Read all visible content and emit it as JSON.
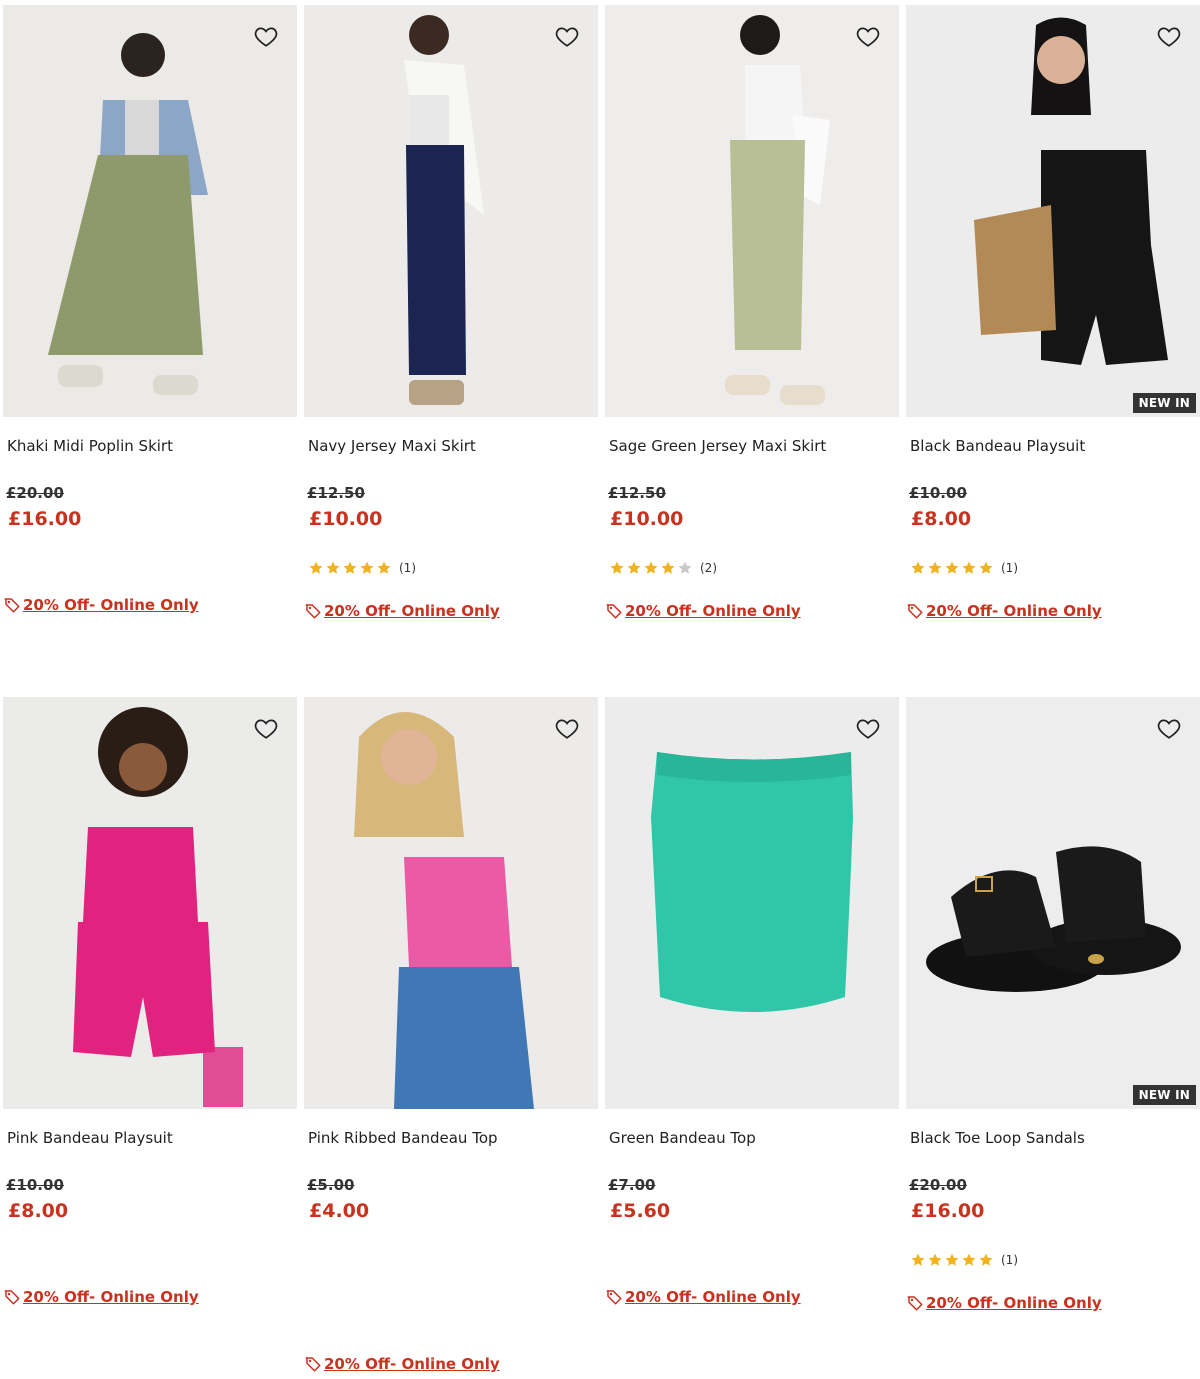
{
  "colors": {
    "accent": "#c8321e",
    "badge_bg": "#333333",
    "star": "#f2b21b",
    "star_empty": "#c9c9c9"
  },
  "icons": {
    "wishlist": "heart-outline-icon",
    "offer": "price-tag-icon",
    "rating": "star-icon"
  },
  "products": [
    {
      "name": "Khaki Midi Poplin Skirt",
      "was": "£20.00",
      "now": "£16.00",
      "rating_stars": null,
      "rating_count": null,
      "offer": "20% Off- Online Only",
      "badge": null
    },
    {
      "name": "Navy Jersey Maxi Skirt",
      "was": "£12.50",
      "now": "£10.00",
      "rating_stars": 5,
      "rating_count": "(1)",
      "offer": "20% Off- Online Only",
      "badge": null
    },
    {
      "name": "Sage Green Jersey Maxi Skirt",
      "was": "£12.50",
      "now": "£10.00",
      "rating_stars": 4,
      "rating_count": "(2)",
      "offer": "20% Off- Online Only",
      "badge": null
    },
    {
      "name": "Black Bandeau Playsuit",
      "was": "£10.00",
      "now": "£8.00",
      "rating_stars": 5,
      "rating_count": "(1)",
      "offer": "20% Off- Online Only",
      "badge": "NEW IN"
    },
    {
      "name": "Pink Bandeau Playsuit",
      "was": "£10.00",
      "now": "£8.00",
      "rating_stars": null,
      "rating_count": null,
      "offer": "20% Off- Online Only",
      "badge": null
    },
    {
      "name": "Pink Ribbed Bandeau Top",
      "was": "£5.00",
      "now": "£4.00",
      "rating_stars": null,
      "rating_count": null,
      "offer": "20% Off- Online Only",
      "badge": null,
      "swatches": [
        "#1b2646",
        "#e8468e"
      ]
    },
    {
      "name": "Green Bandeau Top",
      "was": "£7.00",
      "now": "£5.60",
      "rating_stars": null,
      "rating_count": null,
      "offer": "20% Off- Online Only",
      "badge": null
    },
    {
      "name": "Black Toe Loop Sandals",
      "was": "£20.00",
      "now": "£16.00",
      "rating_stars": 5,
      "rating_count": "(1)",
      "offer": "20% Off- Online Only",
      "badge": "NEW IN"
    }
  ]
}
